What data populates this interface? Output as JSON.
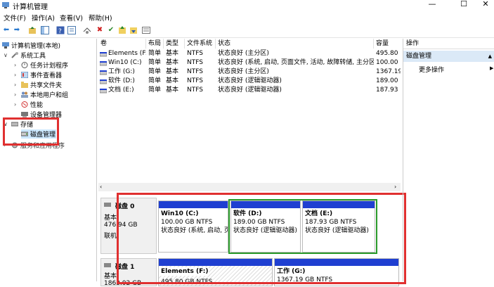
{
  "window": {
    "title": "计算机管理",
    "min": "—",
    "max": "☐",
    "close": "✕"
  },
  "menu": [
    "文件(F)",
    "操作(A)",
    "查看(V)",
    "帮助(H)"
  ],
  "tree": {
    "root": "计算机管理(本地)",
    "system_tools": "系统工具",
    "task_scheduler": "任务计划程序",
    "event_viewer": "事件查看器",
    "shared_folders": "共享文件夹",
    "local_users": "本地用户和组",
    "performance": "性能",
    "device_manager": "设备管理器",
    "storage": "存储",
    "disk_management": "磁盘管理",
    "services": "服务和应用程序"
  },
  "list": {
    "columns": [
      "卷",
      "布局",
      "类型",
      "文件系统",
      "状态",
      "容量"
    ],
    "rows": [
      [
        "Elements (F:)",
        "简单",
        "基本",
        "NTFS",
        "状态良好 (主分区)",
        "495.80"
      ],
      [
        "Win10 (C:)",
        "简单",
        "基本",
        "NTFS",
        "状态良好 (系统, 启动, 页面文件, 活动, 故障转储, 主分区)",
        "100.00"
      ],
      [
        "工作 (G:)",
        "简单",
        "基本",
        "NTFS",
        "状态良好 (主分区)",
        "1367.19"
      ],
      [
        "软件 (D:)",
        "简单",
        "基本",
        "NTFS",
        "状态良好 (逻辑驱动器)",
        "189.00"
      ],
      [
        "文档 (E:)",
        "简单",
        "基本",
        "NTFS",
        "状态良好 (逻辑驱动器)",
        "187.93"
      ]
    ]
  },
  "disks": [
    {
      "name": "磁盘 0",
      "type": "基本",
      "size": "476.94 GB",
      "status": "联机",
      "partitions": [
        {
          "title": "Win10  (C:)",
          "size": "100.00 GB NTFS",
          "status": "状态良好 (系统, 启动, 页"
        },
        {
          "title": "软件  (D:)",
          "size": "189.00 GB NTFS",
          "status": "状态良好 (逻辑驱动器)"
        },
        {
          "title": "文档  (E:)",
          "size": "187.93 GB NTFS",
          "status": "状态良好 (逻辑驱动器)"
        }
      ]
    },
    {
      "name": "磁盘 1",
      "type": "基本",
      "size": "1863.02 GB",
      "partitions": [
        {
          "title": "Elements  (F:)",
          "size": "495.80 GB NTFS"
        },
        {
          "title": "工作  (G:)",
          "size": "1367.19 GB NTFS"
        }
      ]
    }
  ],
  "actions": {
    "header": "操作",
    "section": "磁盘管理",
    "more": "更多操作",
    "more_arrow": "▶"
  },
  "colors": {
    "selection": "#cce8ff",
    "volume_bar": "#1f3fd1",
    "highlight": "#e03030",
    "logical_border": "#2a9a2a"
  }
}
